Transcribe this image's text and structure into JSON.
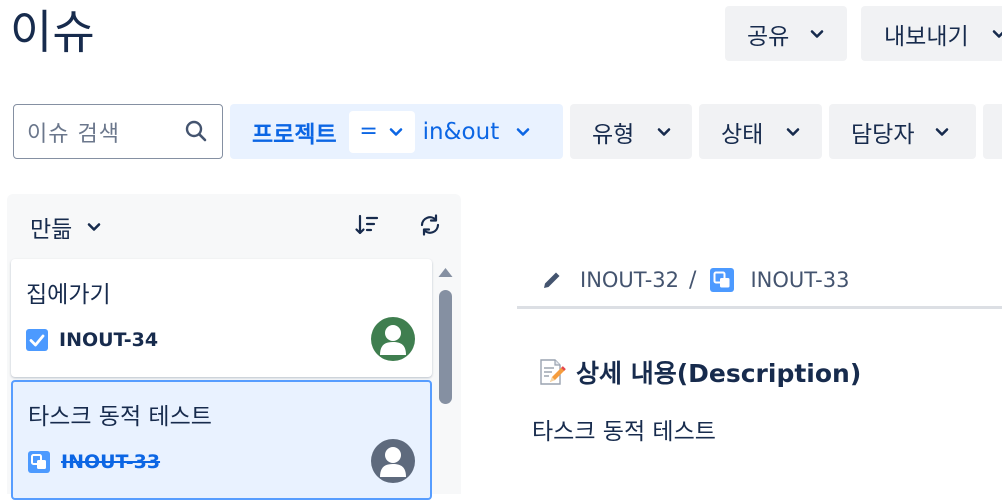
{
  "page": {
    "title": "이슈"
  },
  "header_actions": {
    "share_label": "공유",
    "export_label": "내보내기"
  },
  "filters": {
    "search_placeholder": "이슈 검색",
    "project": {
      "label": "프로젝트",
      "operator": "=",
      "value": "in&out"
    },
    "type_label": "유형",
    "status_label": "상태",
    "assignee_label": "담당자"
  },
  "list": {
    "sort_label": "만듦",
    "items": [
      {
        "title": "집에가기",
        "key": "INOUT-34",
        "type_icon": "task-checkbox-icon"
      },
      {
        "title": "타스크 동적 테스트",
        "key": "INOUT-33",
        "type_icon": "subtask-icon"
      }
    ]
  },
  "detail": {
    "breadcrumb": {
      "parent_key": "INOUT-32",
      "current_key": "INOUT-33",
      "separator": "/"
    },
    "section_title": "상세 내용",
    "section_title_suffix": "(Description)",
    "description": "타스크 동적 테스트"
  },
  "colors": {
    "accent": "#0c66e4",
    "task_icon": "#4c9aff",
    "avatar_green": "#3f7e4f",
    "avatar_gray": "#5e6a7d"
  }
}
